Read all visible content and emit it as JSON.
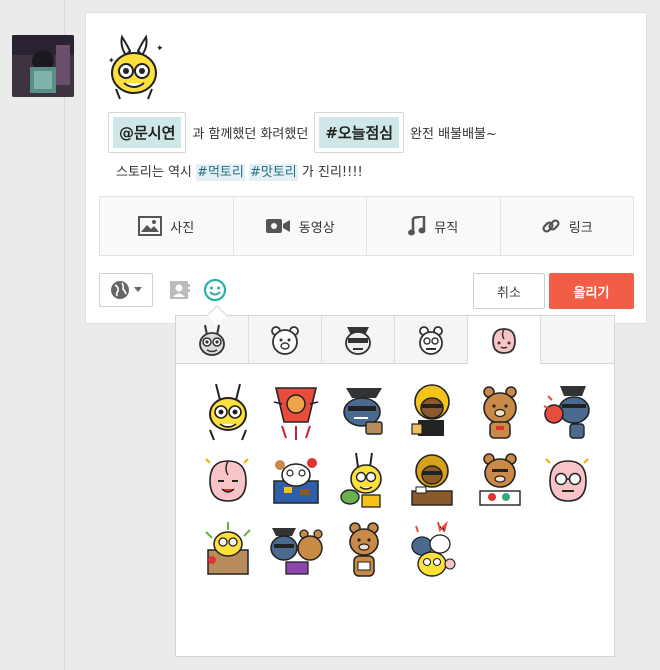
{
  "post": {
    "mention": "@문시연",
    "text_a": "과 함께했던 화려했던",
    "tag_box": "#오늘점심",
    "text_b": "완전 배불배불~",
    "line2_prefix": "스토리는 역시",
    "hashtag1": "#먹토리",
    "hashtag2": "#맛토리",
    "line2_suffix": "가 진리!!!!"
  },
  "media": {
    "photo": "사진",
    "video": "동영상",
    "music": "뮤직",
    "link": "링크"
  },
  "actions": {
    "cancel": "취소",
    "post": "올리기"
  },
  "colors": {
    "post_button": "#f15e45",
    "emoji_accent": "#2bb0a8",
    "mention_bg": "#cfe7e6",
    "hashtag_bg": "#e3f1f5"
  },
  "picker": {
    "tabs": [
      "muzi-tab",
      "frodo-tab",
      "neo-tab",
      "tube-tab",
      "apeach-tab"
    ],
    "active_tab": 4,
    "stickers": [
      "muzi-sticker",
      "ryan-sticker",
      "neo-sticker",
      "frodo-sticker",
      "ryan-sticker",
      "neo-sticker",
      "apeach-sticker",
      "tube-sticker",
      "muzi-sticker",
      "frodo-sticker",
      "ryan-sticker",
      "apeach-sticker",
      "muzi-sticker",
      "neo-sticker",
      "ryan-sticker",
      "group-sticker"
    ]
  }
}
